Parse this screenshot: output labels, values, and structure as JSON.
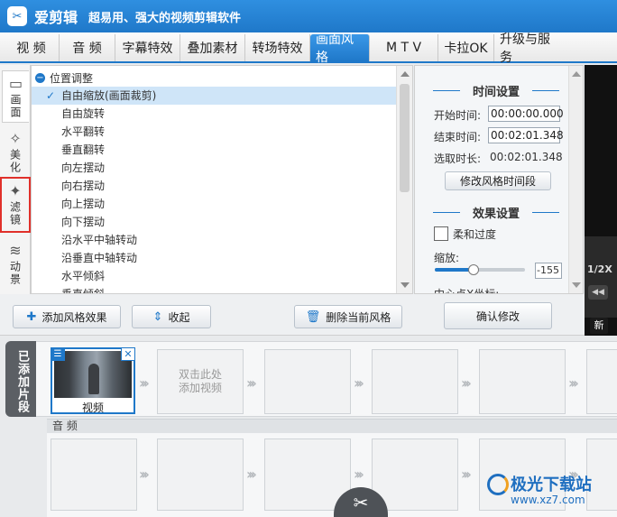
{
  "app": {
    "logo_glyph": "✂",
    "title": "爱剪辑",
    "slogan": "超易用、强大的视频剪辑软件"
  },
  "tabs": [
    {
      "label": "视  频"
    },
    {
      "label": "音  频"
    },
    {
      "label": "字幕特效"
    },
    {
      "label": "叠加素材"
    },
    {
      "label": "转场特效"
    },
    {
      "label": "画面风格",
      "active": true
    },
    {
      "label": "M T V"
    },
    {
      "label": "卡拉OK"
    },
    {
      "label": "升级与服务"
    }
  ],
  "categories": [
    {
      "icon": "screen-icon",
      "glyph": "▭",
      "label": "画面",
      "active": true
    },
    {
      "icon": "magic-wand-icon",
      "glyph": "✧",
      "label": "美化"
    },
    {
      "icon": "filter-wand-icon",
      "glyph": "✦",
      "label": "滤镜",
      "highlighted": true
    },
    {
      "icon": "wave-icon",
      "glyph": "≋",
      "label": "动景"
    }
  ],
  "effects": {
    "group": "位置调整",
    "group_glyph": "−",
    "check_glyph": "✓",
    "items": [
      {
        "label": "自由缩放(画面裁剪)",
        "selected": true
      },
      {
        "label": "自由旋转"
      },
      {
        "label": "水平翻转"
      },
      {
        "label": "垂直翻转"
      },
      {
        "label": "向左摆动"
      },
      {
        "label": "向右摆动"
      },
      {
        "label": "向上摆动"
      },
      {
        "label": "向下摆动"
      },
      {
        "label": "沿水平中轴转动"
      },
      {
        "label": "沿垂直中轴转动"
      },
      {
        "label": "水平倾斜"
      },
      {
        "label": "垂直倾斜"
      }
    ]
  },
  "settings": {
    "time_title": "时间设置",
    "start_label": "开始时间:",
    "start_value": "00:00:00.000",
    "end_label": "结束时间:",
    "end_value": "00:02:01.348",
    "duration_label": "选取时长:",
    "duration_value": "00:02:01.348",
    "modify_button": "修改风格时间段",
    "effect_title": "效果设置",
    "smooth_label": "柔和过度",
    "zoom_label": "缩放:",
    "zoom_value": "-155",
    "zoom_level": 0.43,
    "center_label": "中心点X坐标:"
  },
  "actions": {
    "add_icon_glyph": "✚",
    "add_label": "添加风格效果",
    "collapse_icon_glyph": "⇕",
    "collapse_label": "收起",
    "delete_icon_glyph": "🗑",
    "delete_label": "删除当前风格",
    "confirm_label": "确认修改"
  },
  "player": {
    "speed": "1/2X",
    "prev_glyph": "◀◀",
    "new_label": "新"
  },
  "timeline": {
    "added_label": "已添加片段",
    "clip_label": "视频",
    "clip_menu_glyph": "☰",
    "clip_close_glyph": "✕",
    "empty_hint": "双击此处\n添加视频",
    "audio_label": "音  频",
    "chevron_glyph": "›››",
    "scissor_glyph": "✂"
  },
  "watermark": {
    "text": "极光下载站",
    "url": "www.xz7.com"
  },
  "colors": {
    "accent": "#1f78c9",
    "highlight_border": "#e0302a"
  }
}
